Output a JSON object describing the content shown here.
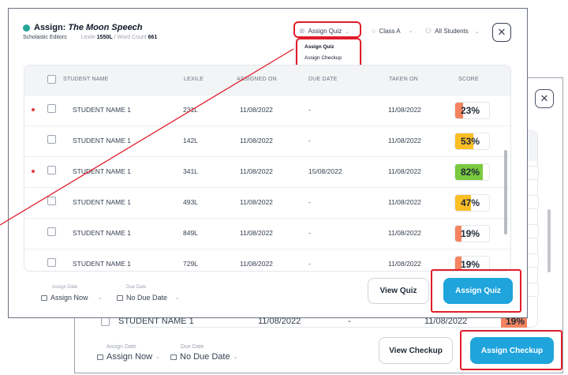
{
  "colors": {
    "accent": "#1fa4dc",
    "highlight": "#e11d2a",
    "teal_dot": "#26a69a"
  },
  "background_modal": {
    "row": {
      "name": "STUDENT NAME 1",
      "assigned_on": "11/08/2022",
      "due_date": "-",
      "taken_on": "11/08/2022",
      "score": "19%"
    },
    "footer": {
      "assign_date_label": "Assign Date",
      "assign_date_value": "Assign Now",
      "due_date_label": "Due Date",
      "due_date_value": "No Due Date"
    },
    "view_button": "View Checkup",
    "assign_button": "Assign Checkup",
    "close_icon": "close-icon"
  },
  "modal": {
    "title_prefix": "Assign: ",
    "title_name": "The Moon Speech",
    "publisher": "Scholastic Editors",
    "lexile_label": "Lexile ",
    "lexile_value": "1550L",
    "word_count_label": " / Word Count ",
    "word_count_value": "661",
    "assign_type_select": "Assign Quiz",
    "assign_type_options": [
      "Assign Quiz",
      "Assign Checkup"
    ],
    "class_select": "Class A",
    "students_select": "All Students",
    "close_icon": "close-icon"
  },
  "table": {
    "columns": [
      "STUDENT NAME",
      "LEXILE",
      "ASSIGNED ON",
      "DUE DATE",
      "TAKEN ON",
      "SCORE"
    ],
    "rows": [
      {
        "flag": true,
        "name": "STUDENT NAME 1",
        "lexile": "231L",
        "assigned_on": "11/08/2022",
        "due_date": "-",
        "taken_on": "11/08/2022",
        "score": "23%",
        "score_pct": 23,
        "score_color": "#f4845f"
      },
      {
        "flag": false,
        "name": "STUDENT NAME 1",
        "lexile": "142L",
        "assigned_on": "11/08/2022",
        "due_date": "-",
        "taken_on": "11/08/2022",
        "score": "53%",
        "score_pct": 53,
        "score_color": "#fbbf24"
      },
      {
        "flag": true,
        "name": "STUDENT NAME 1",
        "lexile": "341L",
        "assigned_on": "11/08/2022",
        "due_date": "15/08/2022",
        "taken_on": "11/08/2022",
        "score": "82%",
        "score_pct": 82,
        "score_color": "#7ac93f"
      },
      {
        "flag": false,
        "name": "STUDENT NAME 1",
        "lexile": "493L",
        "assigned_on": "11/08/2022",
        "due_date": "-",
        "taken_on": "11/08/2022",
        "score": "47%",
        "score_pct": 47,
        "score_color": "#fbbf24"
      },
      {
        "flag": false,
        "name": "STUDENT NAME 1",
        "lexile": "849L",
        "assigned_on": "11/08/2022",
        "due_date": "-",
        "taken_on": "11/08/2022",
        "score": "19%",
        "score_pct": 19,
        "score_color": "#f4845f"
      },
      {
        "flag": false,
        "name": "STUDENT NAME 1",
        "lexile": "729L",
        "assigned_on": "11/08/2022",
        "due_date": "-",
        "taken_on": "11/08/2022",
        "score": "19%",
        "score_pct": 19,
        "score_color": "#f4845f"
      }
    ]
  },
  "footer": {
    "assign_date_label": "Assign Date",
    "assign_date_value": "Assign Now",
    "due_date_label": "Due Date",
    "due_date_value": "No Due Date"
  },
  "view_button": "View Quiz",
  "assign_button": "Assign Quiz"
}
